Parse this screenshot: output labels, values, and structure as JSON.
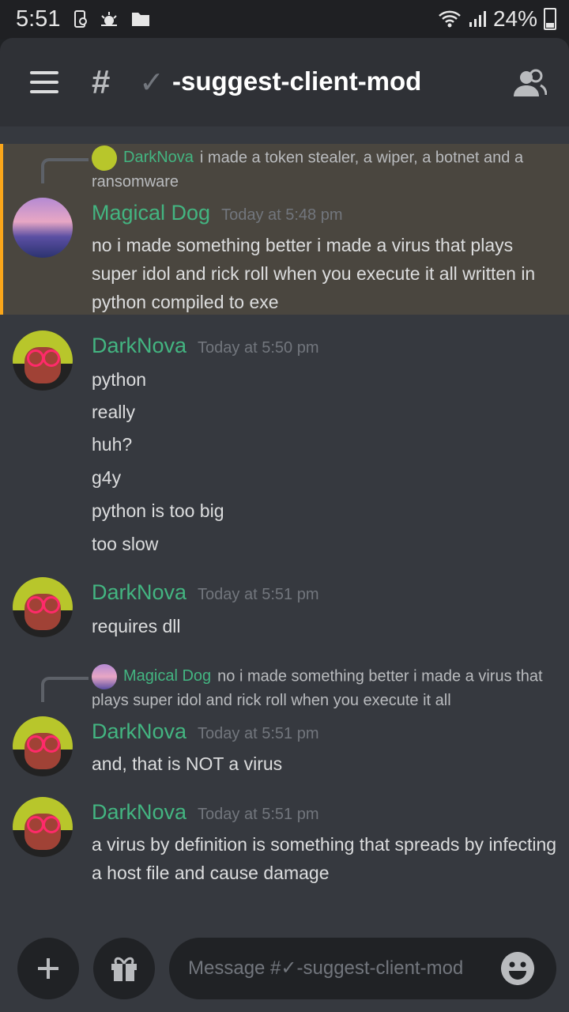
{
  "status_bar": {
    "time": "5:51",
    "battery": "24%"
  },
  "header": {
    "channel_check": "✓",
    "channel_name": "-suggest-client-mod"
  },
  "messages": [
    {
      "reply": {
        "name": "DarkNova",
        "text": "i made a token stealer, a wiper, a botnet and a ransomware"
      },
      "author": "Magical Dog",
      "time": "Today at 5:48 pm",
      "lines": [
        "no  i made something better i made a virus that plays super idol and rick roll when you execute it all written in python compiled to exe"
      ]
    },
    {
      "author": "DarkNova",
      "time": "Today at 5:50 pm",
      "lines": [
        "python",
        "really",
        "huh?",
        "g4y",
        "python is too big",
        "too slow"
      ]
    },
    {
      "author": "DarkNova",
      "time": "Today at 5:51 pm",
      "lines": [
        "requires dll"
      ]
    },
    {
      "reply": {
        "name": "Magical Dog",
        "text": "no  i made something better i made a virus that plays super idol and rick roll when you execute it all"
      },
      "author": "DarkNova",
      "time": "Today at 5:51 pm",
      "lines": [
        "and, that is NOT a virus"
      ]
    },
    {
      "author": "DarkNova",
      "time": "Today at 5:51 pm",
      "lines": [
        "a virus by definition is something that spreads by infecting a host file and cause damage"
      ]
    }
  ],
  "composer": {
    "placeholder": "Message #✓-suggest-client-mod"
  },
  "colors": {
    "accent_green": "#43b581",
    "highlight_bar": "#faa61a",
    "background": "#36393f"
  },
  "icons": [
    "wifi-icon",
    "signal-icon",
    "battery-icon",
    "menu-icon",
    "hashtag-lock-icon",
    "members-icon",
    "plus-icon",
    "gift-icon",
    "emoji-icon"
  ]
}
